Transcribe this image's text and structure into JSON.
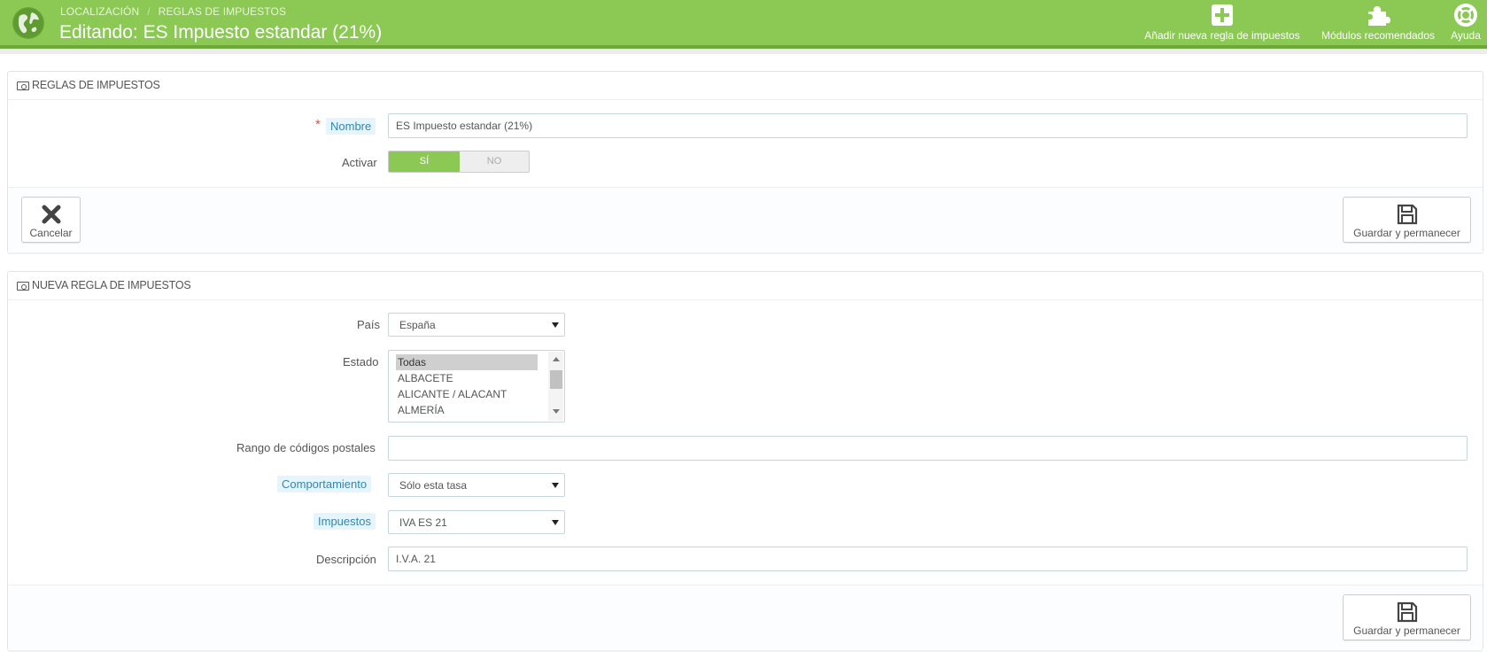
{
  "header": {
    "breadcrumb": [
      "LOCALIZACIÓN",
      "REGLAS DE IMPUESTOS"
    ],
    "breadcrumb_sep": "/",
    "title": "Editando: ES Impuesto estandar (21%)",
    "toolbar": [
      {
        "label": "Añadir nueva regla de impuestos",
        "icon": "plus-square-icon"
      },
      {
        "label": "Módulos recomendados",
        "icon": "puzzle-icon"
      },
      {
        "label": "Ayuda",
        "icon": "lifebuoy-icon"
      }
    ]
  },
  "panel_rules": {
    "heading": "REGLAS DE IMPUESTOS",
    "nombre_label": "Nombre",
    "required_mark": "*",
    "nombre_value": "ES Impuesto estandar (21%)",
    "activar_label": "Activar",
    "switch_yes": "SÍ",
    "switch_no": "NO",
    "switch_value": "SÍ",
    "cancel_label": "Cancelar",
    "save_label": "Guardar y permanecer"
  },
  "panel_new_rule": {
    "heading": "NUEVA REGLA DE IMPUESTOS",
    "pais_label": "País",
    "pais_value": "España",
    "estado_label": "Estado",
    "estado_options": [
      "Todas",
      "ALBACETE",
      "ALICANTE / ALACANT",
      "ALMERÍA"
    ],
    "estado_selected": "Todas",
    "postal_label": "Rango de códigos postales",
    "postal_value": "",
    "comportamiento_label": "Comportamiento",
    "comportamiento_value": "Sólo esta tasa",
    "impuestos_label": "Impuestos",
    "impuestos_value": "IVA ES 21",
    "descripcion_label": "Descripción",
    "descripcion_value": "I.V.A. 21",
    "save_label": "Guardar y permanecer"
  },
  "colors": {
    "header_green": "#8bc954",
    "hint_blue": "#3586ae",
    "required_red": "#e74c3c"
  }
}
